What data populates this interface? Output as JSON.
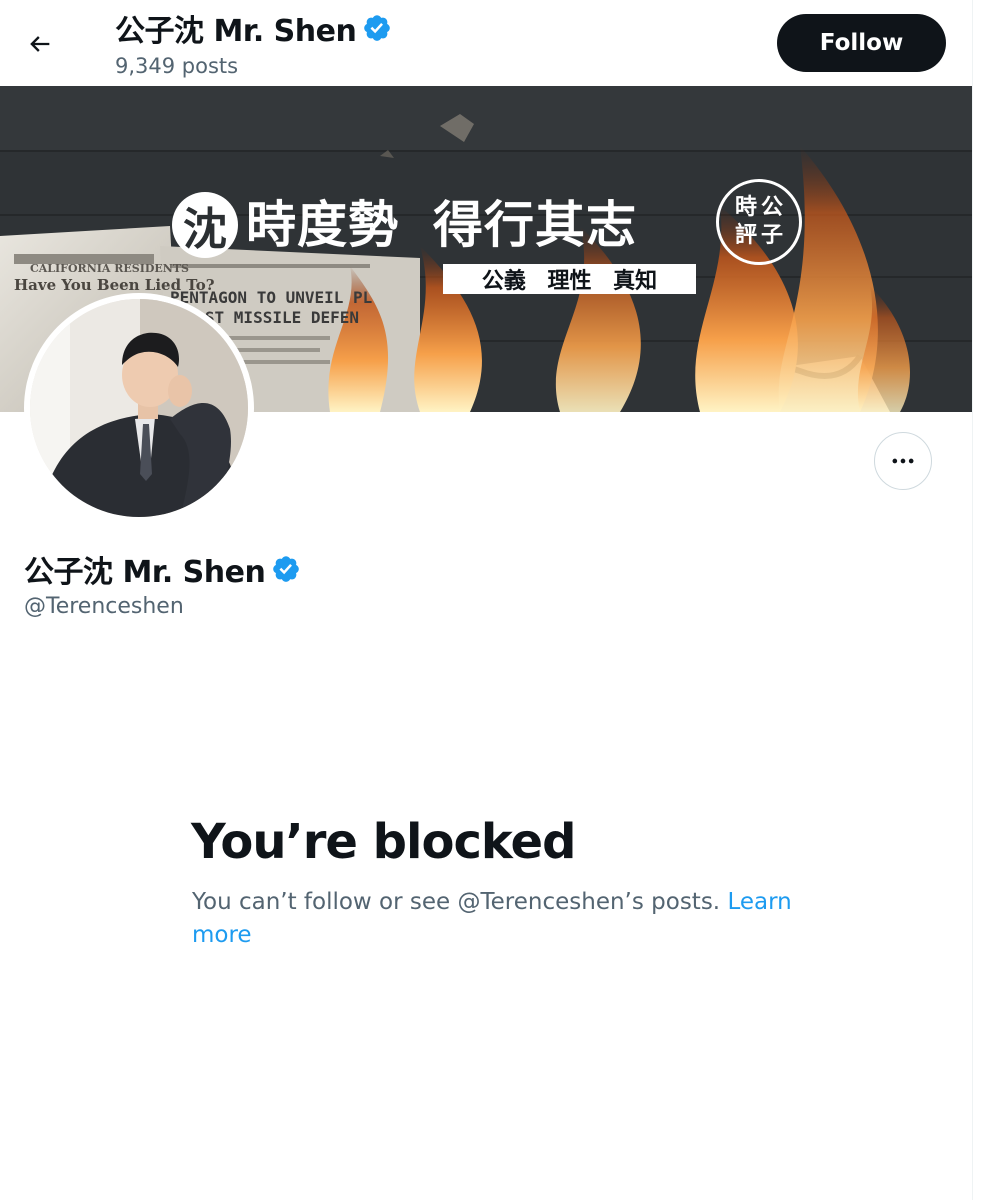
{
  "header": {
    "name": "公子沈 Mr. Shen",
    "posts_count": "9,349 posts",
    "follow_label": "Follow"
  },
  "banner": {
    "logo_char": "沈",
    "slogan_part1": "時度勢",
    "slogan_part2": "得行其志",
    "motto": "公義 理性 真知",
    "seal_chars": [
      "時",
      "公",
      "評",
      "子"
    ],
    "paper_text_1": "PENTAGON TO UNVEIL PL",
    "paper_text_2": "BOOST MISSILE DEFEN",
    "paper_text_3": "CALIFORNIA RESIDENTS",
    "paper_text_4": "Have You Been Lied To?"
  },
  "profile": {
    "name": "公子沈 Mr. Shen",
    "handle": "@Terenceshen"
  },
  "blocked": {
    "title": "You’re blocked",
    "message": "You can’t follow or see @Terenceshen’s posts.",
    "link_label": "Learn more"
  },
  "colors": {
    "text_primary": "#0f1419",
    "text_secondary": "#536471",
    "link": "#1d9bf0",
    "verified": "#1d9bf0",
    "follow_bg": "#0f1419"
  },
  "icons": {
    "back": "arrow-left-icon",
    "verified": "verified-badge-icon",
    "more": "more-horizontal-icon"
  }
}
